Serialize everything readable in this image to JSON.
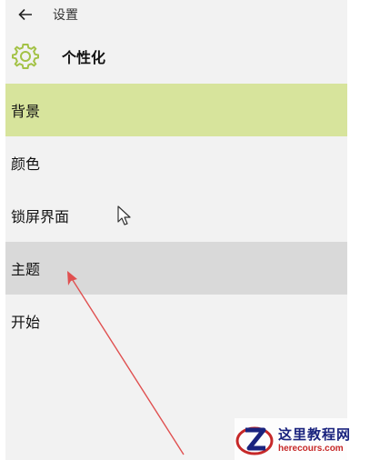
{
  "window": {
    "title": "设置"
  },
  "header": {
    "title": "个性化",
    "icon": "gear-icon",
    "accent_color": "#a3c246"
  },
  "nav": {
    "items": [
      {
        "label": "背景",
        "state": "selected"
      },
      {
        "label": "颜色",
        "state": "normal"
      },
      {
        "label": "锁屏界面",
        "state": "normal"
      },
      {
        "label": "主题",
        "state": "hover"
      },
      {
        "label": "开始",
        "state": "normal"
      }
    ],
    "selected_color": "#d7e49c",
    "hover_color": "#d9d9d9"
  },
  "annotation": {
    "arrow_color": "#e05050"
  },
  "watermark": {
    "title": "这里教程网",
    "url": "herecours.com"
  }
}
